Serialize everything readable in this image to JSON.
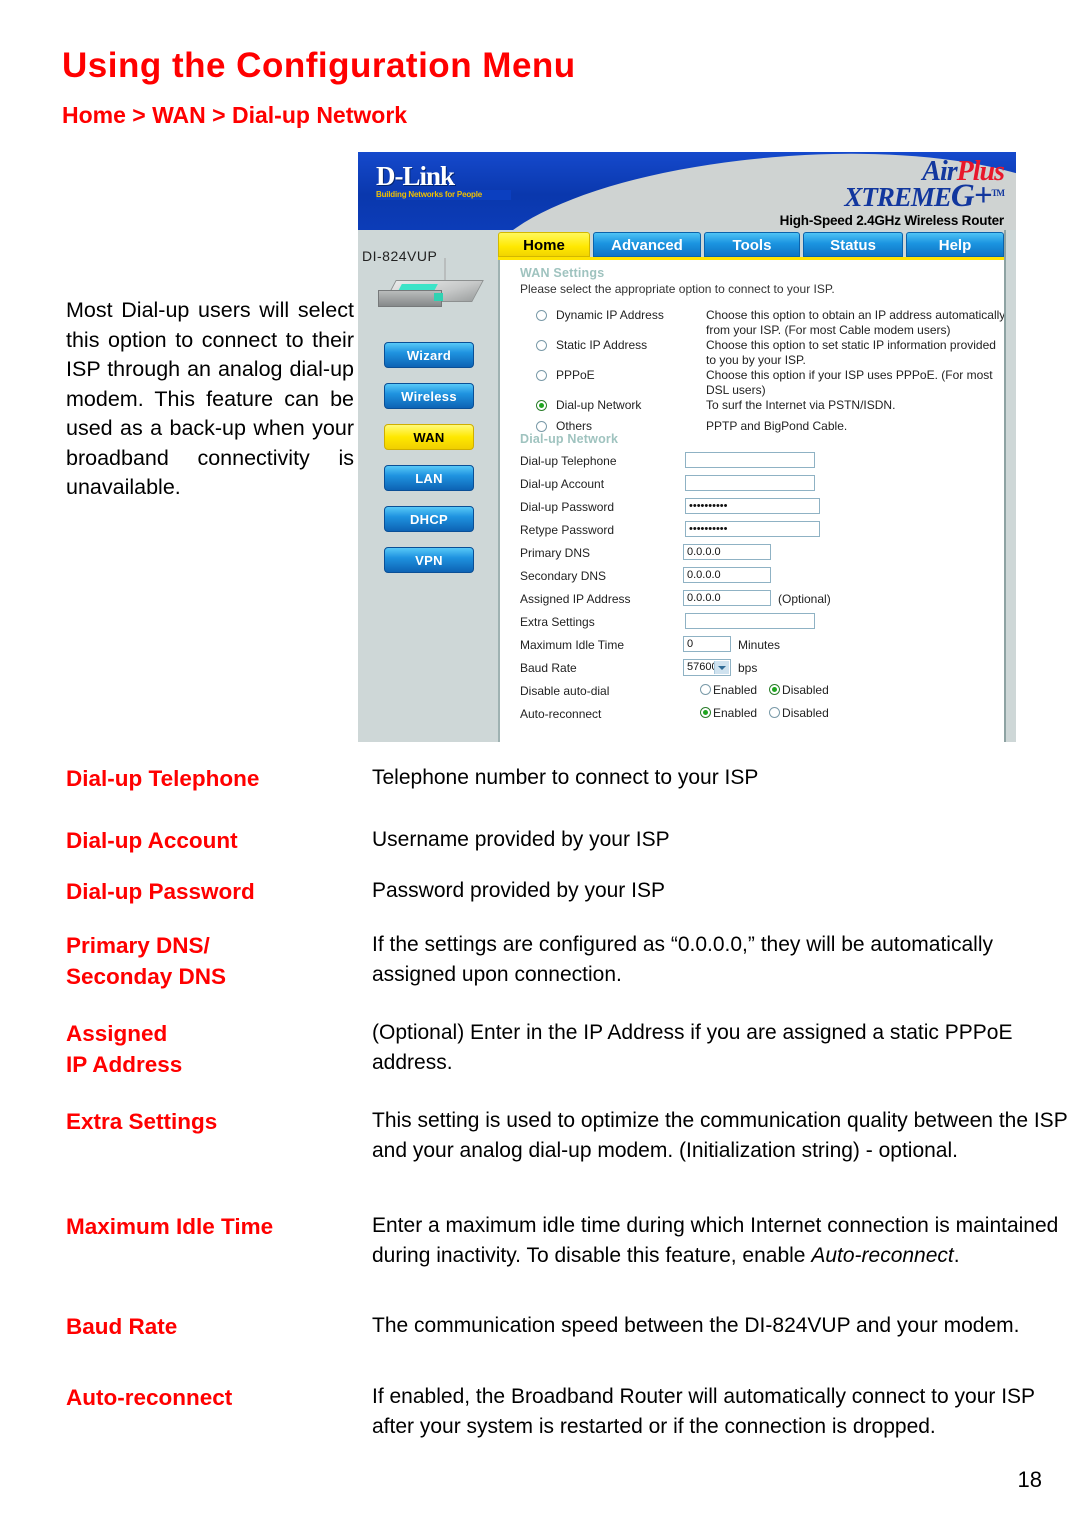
{
  "page": {
    "title": "Using the Configuration Menu",
    "breadcrumb": "Home > WAN > Dial-up Network",
    "intro": "Most Dial-up users will select this option to connect to their ISP through an analog dial-up modem. This feature can be used as a back-up when your broadband connectivity is unavailable.",
    "page_number": "18",
    "accent_color": "#ff0000"
  },
  "router_ui": {
    "brand": {
      "logo": "D-Link",
      "tagline": "Building Networks for People",
      "product_line_air": "Air",
      "product_line_plus": "Plus",
      "product_line_xtreme": "XTREME",
      "product_line_g": "G+",
      "trademark": "TM",
      "product_description": "High-Speed 2.4GHz Wireless Router"
    },
    "tabs": [
      {
        "label": "Home",
        "active": true
      },
      {
        "label": "Advanced",
        "active": false
      },
      {
        "label": "Tools",
        "active": false
      },
      {
        "label": "Status",
        "active": false
      },
      {
        "label": "Help",
        "active": false
      }
    ],
    "sidebar": {
      "model": "DI-824VUP",
      "buttons": [
        {
          "label": "Wizard",
          "active": false
        },
        {
          "label": "Wireless",
          "active": false
        },
        {
          "label": "WAN",
          "active": true
        },
        {
          "label": "LAN",
          "active": false
        },
        {
          "label": "DHCP",
          "active": false
        },
        {
          "label": "VPN",
          "active": false
        }
      ]
    },
    "wan_settings": {
      "section_title": "WAN Settings",
      "description": "Please select the appropriate option to connect to your ISP.",
      "options": [
        {
          "label": "Dynamic IP Address",
          "description": "Choose this option to obtain an IP address automatically from your ISP. (For most Cable modem users)",
          "selected": false
        },
        {
          "label": "Static IP Address",
          "description": "Choose this option to set static IP information provided to you by your ISP.",
          "selected": false
        },
        {
          "label": "PPPoE",
          "description": "Choose this option if your ISP uses PPPoE. (For most DSL users)",
          "selected": false
        },
        {
          "label": "Dial-up Network",
          "description": "To surf the Internet via PSTN/ISDN.",
          "selected": true
        },
        {
          "label": "Others",
          "description": "PPTP and BigPond Cable.",
          "selected": false
        }
      ]
    },
    "dialup_network": {
      "section_title": "Dial-up Network",
      "fields": [
        {
          "label": "Dial-up Telephone",
          "value": "",
          "suffix": ""
        },
        {
          "label": "Dial-up Account",
          "value": "",
          "suffix": ""
        },
        {
          "label": "Dial-up Password",
          "value": "••••••••••",
          "suffix": ""
        },
        {
          "label": "Retype Password",
          "value": "••••••••••",
          "suffix": ""
        },
        {
          "label": "Primary DNS",
          "value": "0.0.0.0",
          "suffix": ""
        },
        {
          "label": "Secondary DNS",
          "value": "0.0.0.0",
          "suffix": ""
        },
        {
          "label": "Assigned IP Address",
          "value": "0.0.0.0",
          "suffix": "(Optional)"
        },
        {
          "label": "Extra Settings",
          "value": "",
          "suffix": ""
        },
        {
          "label": "Maximum Idle Time",
          "value": "0",
          "suffix": "Minutes"
        }
      ],
      "baud_rate": {
        "label": "Baud Rate",
        "value": "57600",
        "suffix": "bps"
      },
      "disable_auto_dial": {
        "label": "Disable auto-dial",
        "enabled_label": "Enabled",
        "disabled_label": "Disabled",
        "selected": "Disabled"
      },
      "auto_reconnect": {
        "label": "Auto-reconnect",
        "enabled_label": "Enabled",
        "disabled_label": "Disabled",
        "selected": "Enabled"
      }
    }
  },
  "definitions": [
    {
      "term": "Dial-up Telephone",
      "desc": "Telephone number to connect to your ISP"
    },
    {
      "term": "Dial-up Account",
      "desc": "Username provided by your ISP"
    },
    {
      "term": "Dial-up Password",
      "desc": "Password provided by your ISP"
    },
    {
      "term": "Primary DNS/\nSeconday DNS",
      "desc": "If the settings are configured as “0.0.0.0,” they will be automatically assigned upon connection."
    },
    {
      "term": "Assigned\nIP Address",
      "desc": "(Optional) Enter in the IP Address if you are assigned a static PPPoE address."
    },
    {
      "term": "Extra Settings",
      "desc": "This setting is used to optimize the communication quality between the ISP and your analog dial-up modem. (Initialization string) - optional."
    },
    {
      "term": "Maximum Idle Time",
      "desc_pre": "Enter a maximum idle time during which Internet connection is maintained during inactivity.  To disable this feature, enable ",
      "desc_em": "Auto-reconnect",
      "desc_post": "."
    },
    {
      "term": "Baud Rate",
      "desc": "The communication speed between the DI-824VUP and your modem."
    },
    {
      "term": "Auto-reconnect",
      "desc": "If enabled, the Broadband Router will automatically connect to your ISP after your system is restarted or if the connection is dropped."
    }
  ]
}
